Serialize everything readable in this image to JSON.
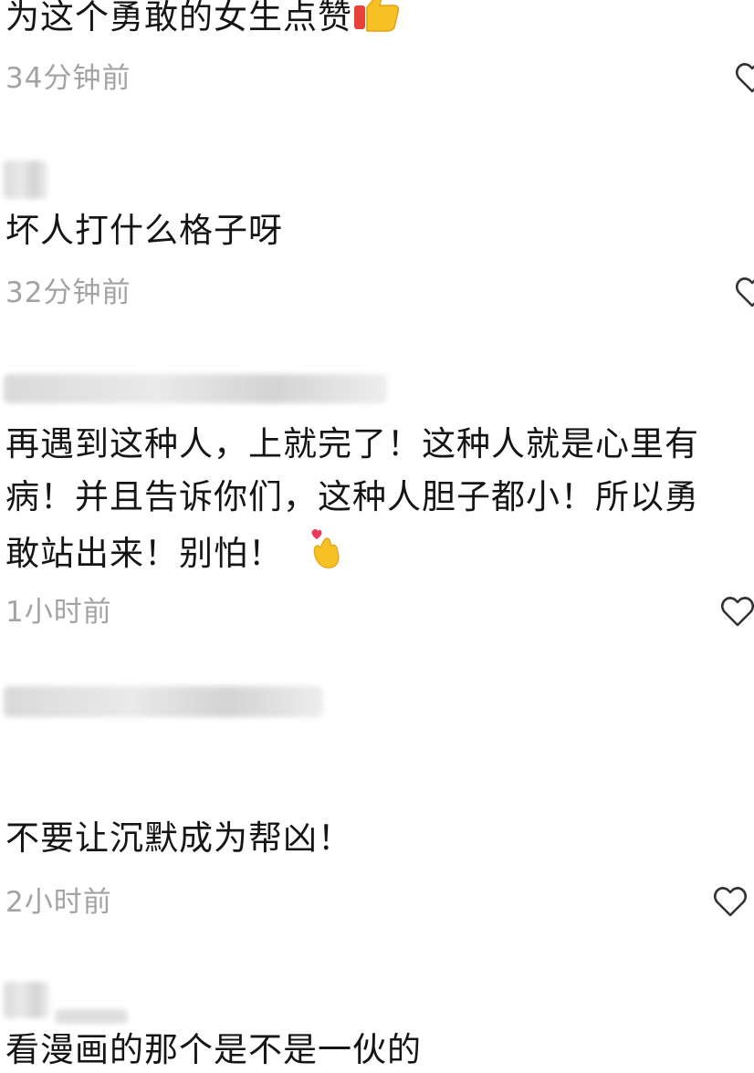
{
  "comments": [
    {
      "text": "为这个勇敢的女生点赞",
      "emoji": "thumbs-up-icon",
      "time": "34分钟前"
    },
    {
      "text": "坏人打什么格子呀",
      "time": "32分钟前"
    },
    {
      "lines": [
        "再遇到这种人，上就完了！这种人就是心里有",
        "病！并且告诉你们，这种人胆子都小！所以勇",
        "敢站出来！别怕！"
      ],
      "emoji": "finger-heart-icon",
      "time": "1小时前"
    },
    {
      "text": "不要让沉默成为帮凶！",
      "time": "2小时前"
    },
    {
      "text": "看漫画的那个是不是一伙的"
    }
  ],
  "colors": {
    "text": "#151515",
    "timestamp": "#a3a3a3",
    "like_outline": "#333333"
  }
}
